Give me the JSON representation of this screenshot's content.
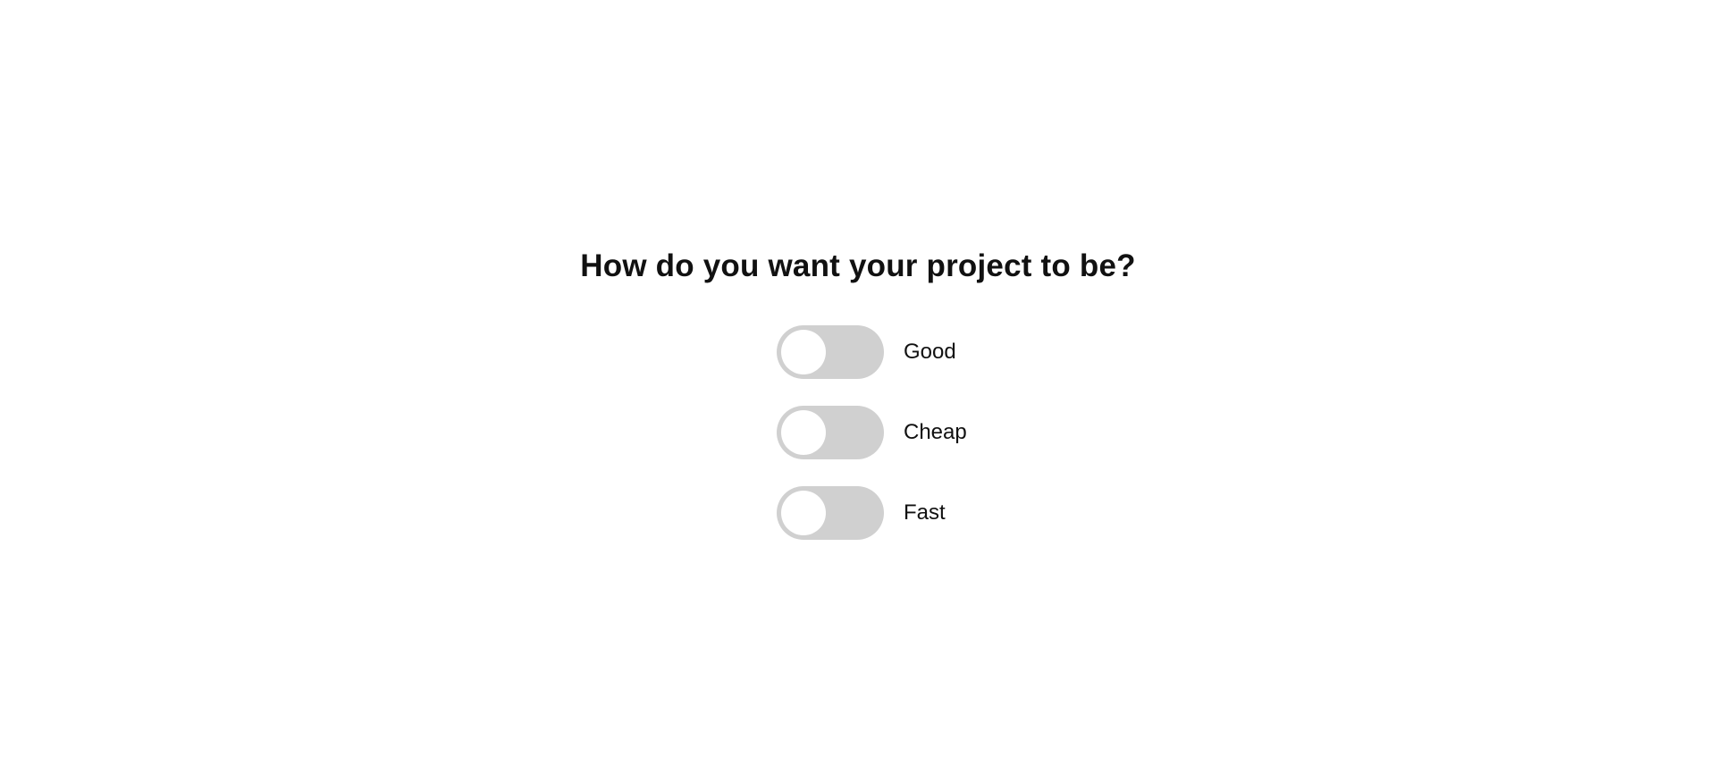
{
  "heading": "How do you want your project to be?",
  "colors": {
    "track_off": "#d0d0d0",
    "knob": "#ffffff",
    "text": "#111111"
  },
  "options": [
    {
      "label": "Good",
      "checked": false
    },
    {
      "label": "Cheap",
      "checked": false
    },
    {
      "label": "Fast",
      "checked": false
    }
  ]
}
